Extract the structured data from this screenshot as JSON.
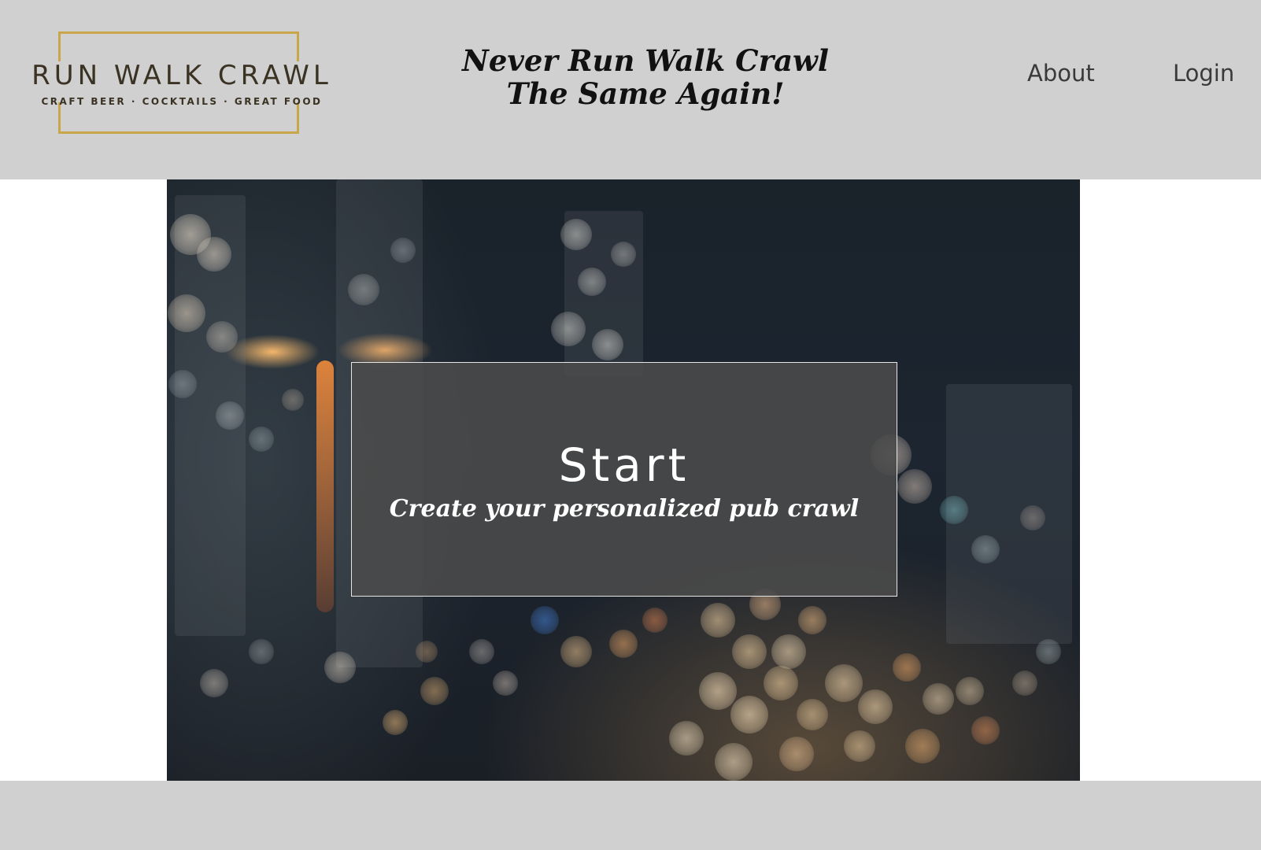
{
  "header": {
    "logo": {
      "title": "RUN WALK CRAWL",
      "tagline": "CRAFT BEER · COCKTAILS · GREAT FOOD",
      "frame_color": "#c9a64a"
    },
    "slogan_line1": "Never Run Walk Crawl",
    "slogan_line2": "The Same Again!",
    "nav": {
      "about": "About",
      "login": "Login"
    }
  },
  "hero": {
    "start_title": "Start",
    "start_subtitle": "Create your personalized pub crawl"
  },
  "colors": {
    "header_bg": "#d0d0d0",
    "footer_bg": "#d0d0d0",
    "overlay_bg": "#4b4b4b",
    "accent_gold": "#c9a64a"
  }
}
